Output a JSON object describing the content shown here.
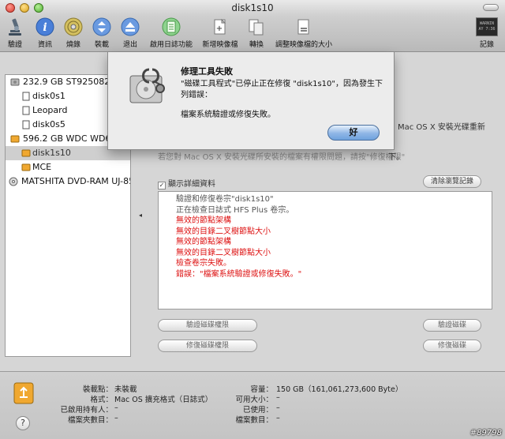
{
  "window": {
    "title": "disk1s10"
  },
  "toolbar": {
    "items": [
      {
        "label": "驗證",
        "icon": "microscope-icon"
      },
      {
        "label": "資訊",
        "icon": "info-icon"
      },
      {
        "label": "燒錄",
        "icon": "burn-icon"
      },
      {
        "label": "裝載",
        "icon": "mount-icon"
      },
      {
        "label": "退出",
        "icon": "eject-icon"
      },
      {
        "label": "啟用日誌功能",
        "icon": "journal-icon"
      },
      {
        "label": "新增映像檔",
        "icon": "new-image-icon"
      },
      {
        "label": "轉換",
        "icon": "convert-icon"
      },
      {
        "label": "調整映像檔的大小",
        "icon": "resize-image-icon"
      }
    ],
    "log_label": "記錄",
    "log_icon_text": "WARNIN\nAY 7:36"
  },
  "sidebar": {
    "items": [
      {
        "label": "232.9 GB ST9250827A",
        "level": 1,
        "icon": "hard-disk-icon"
      },
      {
        "label": "disk0s1",
        "level": 2,
        "icon": "volume-icon"
      },
      {
        "label": "Leopard",
        "level": 2,
        "icon": "volume-icon"
      },
      {
        "label": "disk0s5",
        "level": 2,
        "icon": "volume-icon"
      },
      {
        "label": "596.2 GB WDC WD64",
        "level": 1,
        "icon": "external-disk-icon"
      },
      {
        "label": "disk1s10",
        "level": 2,
        "icon": "external-volume-icon",
        "selected": true
      },
      {
        "label": "MCE",
        "level": 2,
        "icon": "external-volume-icon"
      },
      {
        "label": "MATSHITA DVD-RAM UJ-850",
        "level": 1,
        "icon": "optical-drive-icon"
      }
    ]
  },
  "main": {
    "partial_text_1": "Mac OS X 安裝光碟重新",
    "partial_text_2": "若您對 Mac OS X 安裝光碟所安裝的檔案有權限問題，請按\"修復權限\"",
    "partial_text_3": "下。",
    "show_details_label": "顯示詳細資料",
    "show_details_checked": true,
    "clear_history_label": "清除瀏覽記錄",
    "log_lines": [
      {
        "text": "驗證和修復卷宗\"disk1s10\"",
        "error": false
      },
      {
        "text": "正在檢查日誌式 HFS Plus 卷宗。",
        "error": false
      },
      {
        "text": "無效的節點架構",
        "error": true
      },
      {
        "text": "無效的目錄二叉樹節點大小",
        "error": true
      },
      {
        "text": "無效的節點架構",
        "error": true
      },
      {
        "text": "無效的目錄二叉樹節點大小",
        "error": true
      },
      {
        "text": "檢查卷宗失敗。",
        "error": true
      },
      {
        "text": "錯誤：\"檔案系統驗證或修復失敗。\"",
        "error": true
      }
    ],
    "verify_permissions_label": "驗證磁碟權限",
    "repair_permissions_label": "修復磁碟權限",
    "verify_disk_label": "驗證磁碟",
    "repair_disk_label": "修復磁碟"
  },
  "footer": {
    "left": [
      {
        "label": "裝載點：",
        "value": "未裝載"
      },
      {
        "label": "格式：",
        "value": "Mac OS 擴充格式（日誌式）"
      },
      {
        "label": "已啟用持有人：",
        "value": "–"
      },
      {
        "label": "檔案夾數目：",
        "value": "–"
      }
    ],
    "right": [
      {
        "label": "容量：",
        "value": "150 GB（161,061,273,600 Byte）"
      },
      {
        "label": "可用大小：",
        "value": "–"
      },
      {
        "label": "已使用：",
        "value": "–"
      },
      {
        "label": "檔案數目：",
        "value": "–"
      }
    ]
  },
  "dialog": {
    "title": "修理工具失敗",
    "message": "\"磁碟工具程式\"已停止正在修復 \"disk1s10\"，因為發生下列錯誤：",
    "detail": "檔案系統驗證或修復失敗。",
    "ok_label": "好"
  },
  "watermark": "#89798"
}
